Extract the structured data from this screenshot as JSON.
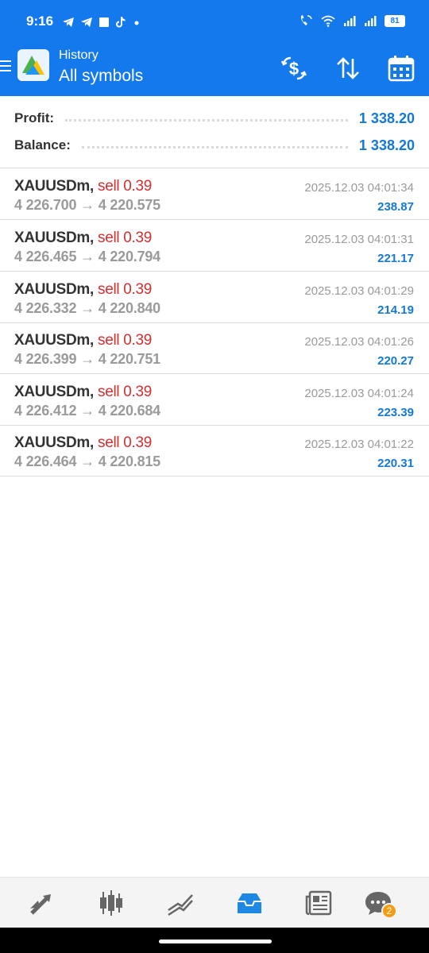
{
  "status_bar": {
    "time": "9:16",
    "notification_icons": [
      "telegram-icon",
      "telegram-icon",
      "square-app-icon",
      "tiktok-icon",
      "dot-icon"
    ],
    "system_icons": [
      "wifi-calling-icon",
      "wifi-icon",
      "signal-icon",
      "signal-icon"
    ],
    "battery": "81"
  },
  "app_bar": {
    "subtitle": "History",
    "title": "All symbols",
    "actions": [
      "deposit-withdraw-icon",
      "sort-icon",
      "calendar-icon"
    ]
  },
  "summary": {
    "profit_label": "Profit:",
    "profit_value": "1 338.20",
    "balance_label": "Balance:",
    "balance_value": "1 338.20"
  },
  "trades": [
    {
      "symbol": "XAUUSDm,",
      "side": "sell 0.39",
      "open_price": "4 226.700",
      "arrow": "→",
      "close_price": "4 220.575",
      "time": "2025.12.03 04:01:34",
      "profit": "238.87"
    },
    {
      "symbol": "XAUUSDm,",
      "side": "sell 0.39",
      "open_price": "4 226.465",
      "arrow": "→",
      "close_price": "4 220.794",
      "time": "2025.12.03 04:01:31",
      "profit": "221.17"
    },
    {
      "symbol": "XAUUSDm,",
      "side": "sell 0.39",
      "open_price": "4 226.332",
      "arrow": "→",
      "close_price": "4 220.840",
      "time": "2025.12.03 04:01:29",
      "profit": "214.19"
    },
    {
      "symbol": "XAUUSDm,",
      "side": "sell 0.39",
      "open_price": "4 226.399",
      "arrow": "→",
      "close_price": "4 220.751",
      "time": "2025.12.03 04:01:26",
      "profit": "220.27"
    },
    {
      "symbol": "XAUUSDm,",
      "side": "sell 0.39",
      "open_price": "4 226.412",
      "arrow": "→",
      "close_price": "4 220.684",
      "time": "2025.12.03 04:01:24",
      "profit": "223.39"
    },
    {
      "symbol": "XAUUSDm,",
      "side": "sell 0.39",
      "open_price": "4 226.464",
      "arrow": "→",
      "close_price": "4 220.815",
      "time": "2025.12.03 04:01:22",
      "profit": "220.31"
    }
  ],
  "bottom_nav": {
    "items": [
      "quotes-icon",
      "chart-icon",
      "trade-icon",
      "history-icon",
      "news-icon",
      "messages-icon"
    ],
    "active": "history-icon",
    "messages_badge": "2"
  },
  "colors": {
    "primary": "#1479ec",
    "sell": "#d32f2f",
    "value_blue": "#1479d6",
    "muted": "#9a9a9a",
    "badge": "#f39c12"
  }
}
